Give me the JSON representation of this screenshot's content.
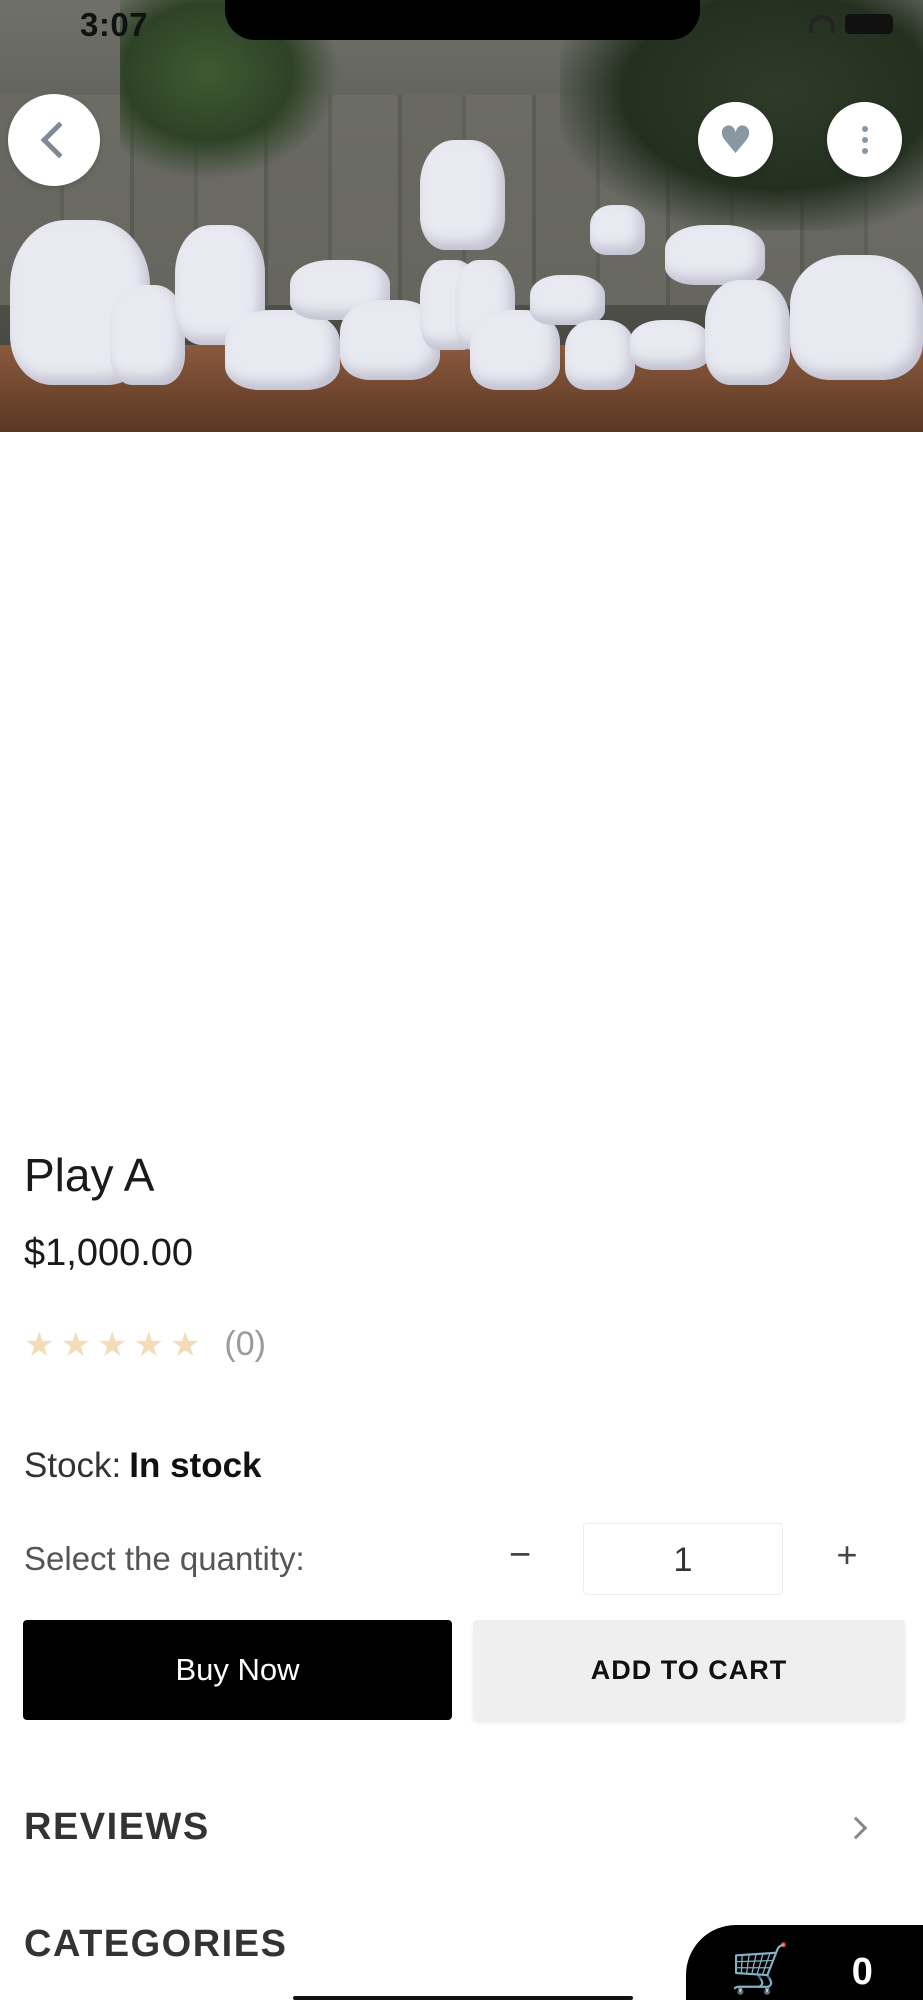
{
  "status_bar": {
    "time": "3:07"
  },
  "hero": {
    "image_alt": ""
  },
  "product": {
    "title": "Play A",
    "price": "$1,000.00",
    "rating_stars": 0,
    "rating_max": 5,
    "rating_count": "(0)",
    "stock_label": "Stock:",
    "stock_value": "In stock",
    "quantity_label": "Select the quantity:",
    "quantity": "1",
    "minus": "−",
    "plus": "+"
  },
  "actions": {
    "buy_now": "Buy Now",
    "add_to_cart": "ADD TO CART"
  },
  "sections": {
    "reviews": "REVIEWS",
    "categories": "CATEGORIES"
  },
  "cart": {
    "count": "0"
  },
  "icons": {
    "back": "chevron-left-icon",
    "favorite": "heart-icon",
    "more": "more-vertical-icon",
    "star": "star-icon",
    "cart": "shopping-cart-icon"
  },
  "colors": {
    "primary_button": "#000000",
    "secondary_button": "#efefef",
    "star_empty": "#f5dcb8",
    "icon_grey": "#8797a3"
  }
}
